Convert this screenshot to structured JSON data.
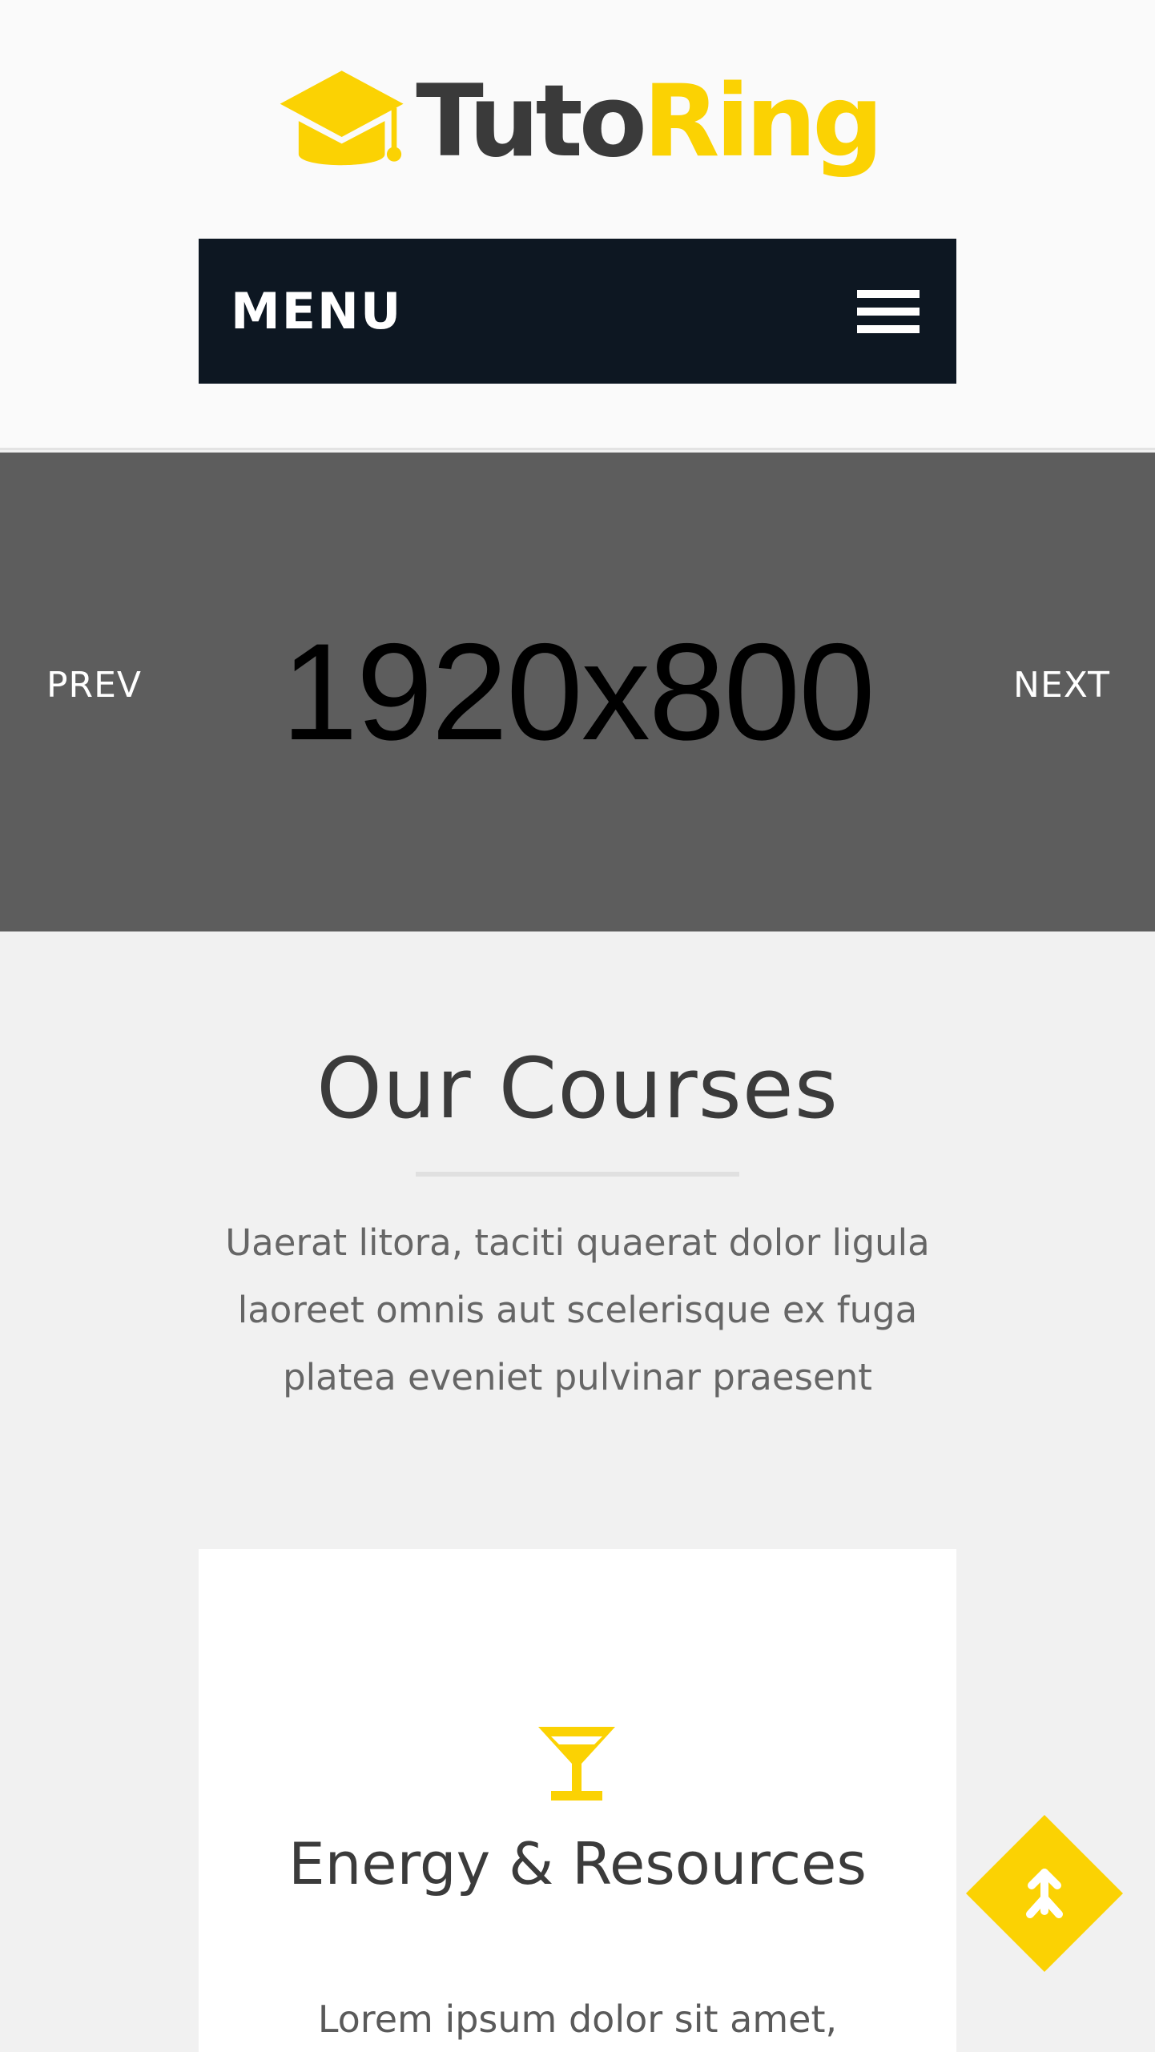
{
  "header": {
    "logo": {
      "text_dark": "Tuto",
      "text_accent": "Ring"
    },
    "menu_label": "MENU"
  },
  "slider": {
    "placeholder_text": "1920x800",
    "prev_label": "PREV",
    "next_label": "NEXT"
  },
  "courses": {
    "title": "Our Courses",
    "description": "Uaerat litora, taciti quaerat dolor ligula laoreet omnis aut scelerisque ex fuga platea eveniet pulvinar praesent",
    "cards": [
      {
        "icon": "martini-glass-icon",
        "title": "Energy & Resources",
        "text": "Lorem ipsum dolor sit amet,"
      }
    ]
  },
  "colors": {
    "accent": "#fbd203",
    "navbar": "#0d1722",
    "slider_bg": "#5d5d5d",
    "page_bg": "#f1f1f1"
  }
}
